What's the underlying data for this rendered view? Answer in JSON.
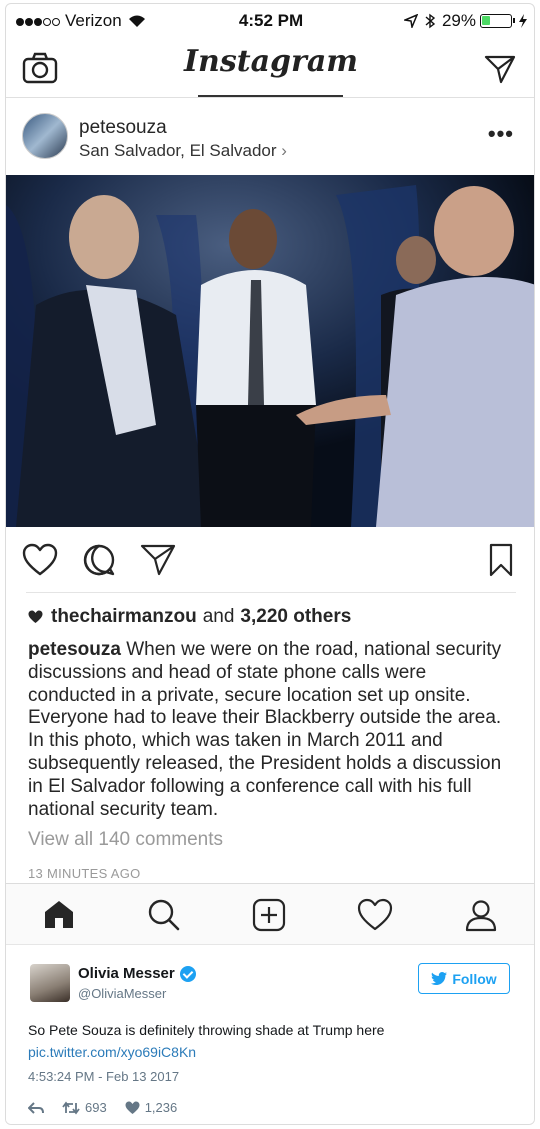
{
  "status_bar": {
    "carrier": "Verizon",
    "time": "4:52 PM",
    "battery": "29%",
    "battery_level": 0.29
  },
  "header": {
    "logo": "Instagram"
  },
  "post": {
    "username": "petesouza",
    "location": "San Salvador, El Salvador",
    "likes_user": "thechairmanzou",
    "likes_and": "and",
    "likes_others": "3,220 others",
    "caption_user": "petesouza",
    "caption_text": " When we were on the road, national security discussions and head of state phone calls were conducted in a private, secure location set up onsite. Everyone had to leave their Blackberry outside the area. In this photo, which was taken in March 2011 and subsequently released, the President holds a discussion in El Salvador following a conference call with his full national security team.",
    "view_all_comments": "View all 140 comments",
    "time_ago": "13 MINUTES AGO"
  },
  "tweet": {
    "name": "Olivia Messer",
    "handle": "@OliviaMesser",
    "follow_label": "Follow",
    "text": "So Pete Souza is definitely throwing shade at Trump here",
    "link": "pic.twitter.com/xyo69iC8Kn",
    "timestamp": "4:53:24 PM - Feb 13 2017",
    "retweets": "693",
    "likes": "1,236"
  },
  "colors": {
    "twitter_blue": "#1da1f2",
    "link_blue": "#2b7bb9",
    "muted_gray": "#9a9a9a",
    "battery_green": "#4cd964"
  }
}
